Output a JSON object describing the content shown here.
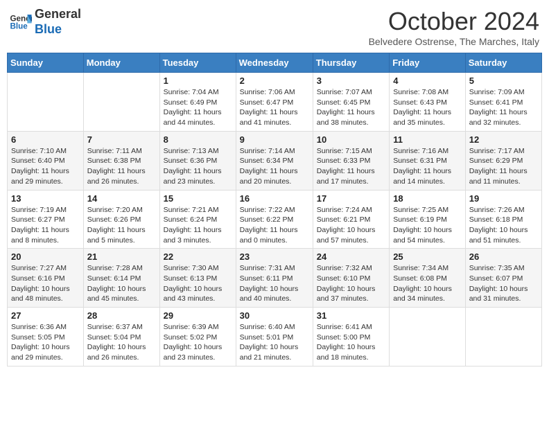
{
  "header": {
    "logo_line1": "General",
    "logo_line2": "Blue",
    "month": "October 2024",
    "location": "Belvedere Ostrense, The Marches, Italy"
  },
  "days_of_week": [
    "Sunday",
    "Monday",
    "Tuesday",
    "Wednesday",
    "Thursday",
    "Friday",
    "Saturday"
  ],
  "weeks": [
    [
      {
        "day": "",
        "info": ""
      },
      {
        "day": "",
        "info": ""
      },
      {
        "day": "1",
        "info": "Sunrise: 7:04 AM\nSunset: 6:49 PM\nDaylight: 11 hours and 44 minutes."
      },
      {
        "day": "2",
        "info": "Sunrise: 7:06 AM\nSunset: 6:47 PM\nDaylight: 11 hours and 41 minutes."
      },
      {
        "day": "3",
        "info": "Sunrise: 7:07 AM\nSunset: 6:45 PM\nDaylight: 11 hours and 38 minutes."
      },
      {
        "day": "4",
        "info": "Sunrise: 7:08 AM\nSunset: 6:43 PM\nDaylight: 11 hours and 35 minutes."
      },
      {
        "day": "5",
        "info": "Sunrise: 7:09 AM\nSunset: 6:41 PM\nDaylight: 11 hours and 32 minutes."
      }
    ],
    [
      {
        "day": "6",
        "info": "Sunrise: 7:10 AM\nSunset: 6:40 PM\nDaylight: 11 hours and 29 minutes."
      },
      {
        "day": "7",
        "info": "Sunrise: 7:11 AM\nSunset: 6:38 PM\nDaylight: 11 hours and 26 minutes."
      },
      {
        "day": "8",
        "info": "Sunrise: 7:13 AM\nSunset: 6:36 PM\nDaylight: 11 hours and 23 minutes."
      },
      {
        "day": "9",
        "info": "Sunrise: 7:14 AM\nSunset: 6:34 PM\nDaylight: 11 hours and 20 minutes."
      },
      {
        "day": "10",
        "info": "Sunrise: 7:15 AM\nSunset: 6:33 PM\nDaylight: 11 hours and 17 minutes."
      },
      {
        "day": "11",
        "info": "Sunrise: 7:16 AM\nSunset: 6:31 PM\nDaylight: 11 hours and 14 minutes."
      },
      {
        "day": "12",
        "info": "Sunrise: 7:17 AM\nSunset: 6:29 PM\nDaylight: 11 hours and 11 minutes."
      }
    ],
    [
      {
        "day": "13",
        "info": "Sunrise: 7:19 AM\nSunset: 6:27 PM\nDaylight: 11 hours and 8 minutes."
      },
      {
        "day": "14",
        "info": "Sunrise: 7:20 AM\nSunset: 6:26 PM\nDaylight: 11 hours and 5 minutes."
      },
      {
        "day": "15",
        "info": "Sunrise: 7:21 AM\nSunset: 6:24 PM\nDaylight: 11 hours and 3 minutes."
      },
      {
        "day": "16",
        "info": "Sunrise: 7:22 AM\nSunset: 6:22 PM\nDaylight: 11 hours and 0 minutes."
      },
      {
        "day": "17",
        "info": "Sunrise: 7:24 AM\nSunset: 6:21 PM\nDaylight: 10 hours and 57 minutes."
      },
      {
        "day": "18",
        "info": "Sunrise: 7:25 AM\nSunset: 6:19 PM\nDaylight: 10 hours and 54 minutes."
      },
      {
        "day": "19",
        "info": "Sunrise: 7:26 AM\nSunset: 6:18 PM\nDaylight: 10 hours and 51 minutes."
      }
    ],
    [
      {
        "day": "20",
        "info": "Sunrise: 7:27 AM\nSunset: 6:16 PM\nDaylight: 10 hours and 48 minutes."
      },
      {
        "day": "21",
        "info": "Sunrise: 7:28 AM\nSunset: 6:14 PM\nDaylight: 10 hours and 45 minutes."
      },
      {
        "day": "22",
        "info": "Sunrise: 7:30 AM\nSunset: 6:13 PM\nDaylight: 10 hours and 43 minutes."
      },
      {
        "day": "23",
        "info": "Sunrise: 7:31 AM\nSunset: 6:11 PM\nDaylight: 10 hours and 40 minutes."
      },
      {
        "day": "24",
        "info": "Sunrise: 7:32 AM\nSunset: 6:10 PM\nDaylight: 10 hours and 37 minutes."
      },
      {
        "day": "25",
        "info": "Sunrise: 7:34 AM\nSunset: 6:08 PM\nDaylight: 10 hours and 34 minutes."
      },
      {
        "day": "26",
        "info": "Sunrise: 7:35 AM\nSunset: 6:07 PM\nDaylight: 10 hours and 31 minutes."
      }
    ],
    [
      {
        "day": "27",
        "info": "Sunrise: 6:36 AM\nSunset: 5:05 PM\nDaylight: 10 hours and 29 minutes."
      },
      {
        "day": "28",
        "info": "Sunrise: 6:37 AM\nSunset: 5:04 PM\nDaylight: 10 hours and 26 minutes."
      },
      {
        "day": "29",
        "info": "Sunrise: 6:39 AM\nSunset: 5:02 PM\nDaylight: 10 hours and 23 minutes."
      },
      {
        "day": "30",
        "info": "Sunrise: 6:40 AM\nSunset: 5:01 PM\nDaylight: 10 hours and 21 minutes."
      },
      {
        "day": "31",
        "info": "Sunrise: 6:41 AM\nSunset: 5:00 PM\nDaylight: 10 hours and 18 minutes."
      },
      {
        "day": "",
        "info": ""
      },
      {
        "day": "",
        "info": ""
      }
    ]
  ]
}
